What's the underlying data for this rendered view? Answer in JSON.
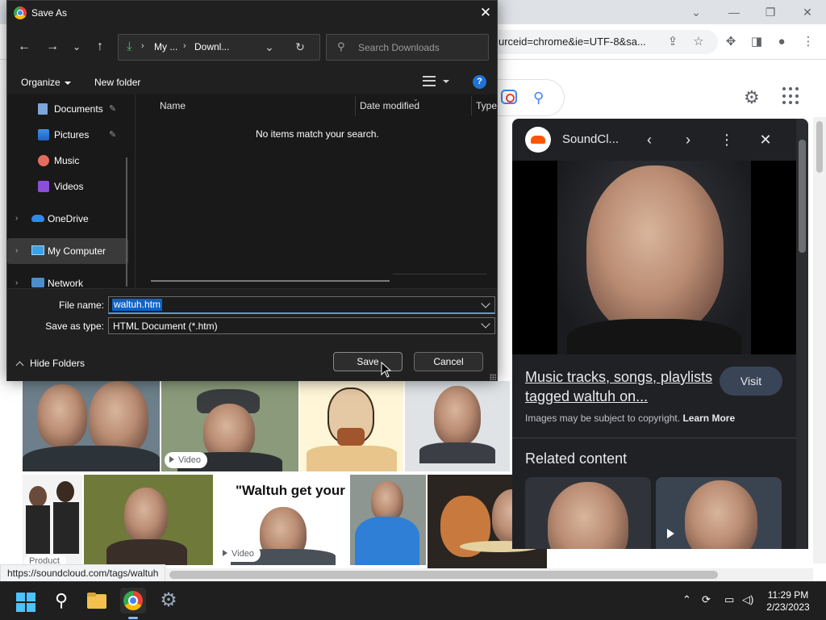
{
  "dialog": {
    "title": "Save As",
    "address": {
      "seg1": "My ...",
      "seg2": "Downl..."
    },
    "search_placeholder": "Search Downloads",
    "commands": {
      "organize": "Organize",
      "new_folder": "New folder"
    },
    "nav_items": [
      {
        "label": "Documents"
      },
      {
        "label": "Pictures"
      },
      {
        "label": "Music"
      },
      {
        "label": "Videos"
      },
      {
        "label": "OneDrive"
      },
      {
        "label": "My Computer"
      },
      {
        "label": "Network"
      }
    ],
    "columns": {
      "name": "Name",
      "date_modified": "Date modified",
      "type": "Type"
    },
    "empty_message": "No items match your search.",
    "file_name_label": "File name:",
    "file_name_value": "waltuh.htm",
    "save_type_label": "Save as type:",
    "save_type_value": "HTML Document (*.htm)",
    "hide_folders": "Hide Folders",
    "save_button": "Save",
    "cancel_button": "Cancel"
  },
  "browser": {
    "url_fragment": "urceid=chrome&ie=UTF-8&sa...",
    "status_url": "https://soundcloud.com/tags/waltuh"
  },
  "thumbnails": {
    "video_badge_1": "Video",
    "video_badge_2": "Video",
    "product_badge": "Product",
    "meme_text": "\"Waltuh get your D"
  },
  "side_panel": {
    "source": "SoundCl...",
    "link_title": "Music tracks, songs, playlists tagged waltuh on...",
    "visit": "Visit",
    "copyright_text": "Images may be subject to copyright.",
    "learn_more": "Learn More",
    "related": "Related content"
  },
  "taskbar": {
    "time": "11:29 PM",
    "date": "2/23/2023"
  }
}
